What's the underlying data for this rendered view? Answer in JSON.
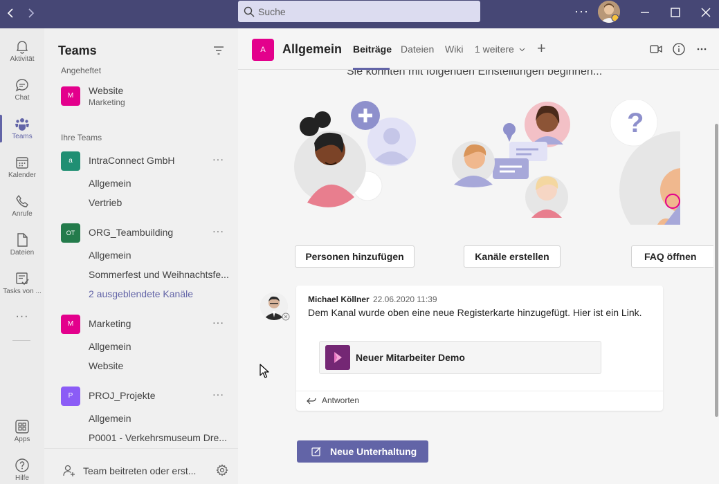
{
  "titlebar": {
    "search_placeholder": "Suche",
    "more": "···"
  },
  "rail": {
    "items": [
      {
        "label": "Aktivität",
        "icon": "bell-icon"
      },
      {
        "label": "Chat",
        "icon": "chat-icon"
      },
      {
        "label": "Teams",
        "icon": "teams-icon",
        "active": true
      },
      {
        "label": "Kalender",
        "icon": "calendar-icon"
      },
      {
        "label": "Anrufe",
        "icon": "phone-icon"
      },
      {
        "label": "Dateien",
        "icon": "file-icon"
      },
      {
        "label": "Tasks von ...",
        "icon": "tasks-icon"
      }
    ],
    "more": "···",
    "apps": "Apps",
    "help": "Hilfe"
  },
  "teamlist": {
    "title": "Teams",
    "pinned_label": "Angeheftet",
    "pinned": {
      "name": "Website",
      "sub": "Marketing",
      "avatar": "M",
      "color": "#e3008c"
    },
    "your_teams_label": "Ihre Teams",
    "teams": [
      {
        "name": "IntraConnect GmbH",
        "avatar": "a",
        "color": "#208f73",
        "channels": [
          "Allgemein",
          "Vertrieb"
        ]
      },
      {
        "name": "ORG_Teambuilding",
        "avatar": "OT",
        "color": "#237b4b",
        "channels": [
          "Allgemein",
          "Sommerfest und Weihnachtsfe..."
        ],
        "hidden_channels": "2 ausgeblendete Kanäle"
      },
      {
        "name": "Marketing",
        "avatar": "M",
        "color": "#e3008c",
        "channels": [
          "Allgemein",
          "Website"
        ]
      },
      {
        "name": "PROJ_Projekte",
        "avatar": "P",
        "color": "#8b5cf6",
        "channels": [
          "Allgemein",
          "P0001 - Verkehrsmuseum Dre..."
        ]
      }
    ],
    "team_more": "···",
    "join": "Team beitreten oder erst..."
  },
  "channel": {
    "avatar": "A",
    "title": "Allgemein",
    "tabs": [
      "Beiträge",
      "Dateien",
      "Wiki",
      "1 weitere"
    ],
    "add_tab": "+"
  },
  "content": {
    "hint": "Sie könnten mit folgenden Einstellungen beginnen...",
    "actions": [
      "Personen hinzufügen",
      "Kanäle erstellen",
      "FAQ öffnen"
    ],
    "post": {
      "author": "Michael Köllner",
      "time": "22.06.2020 11:39",
      "text": "Dem Kanal wurde oben eine neue Registerkarte hinzugefügt. Hier ist ein Link.",
      "card_title": "Neuer Mitarbeiter Demo",
      "reply": "Antworten"
    },
    "new_conversation": "Neue Unterhaltung"
  },
  "colors": {
    "accent": "#6264a7",
    "titlebar": "#464775"
  }
}
